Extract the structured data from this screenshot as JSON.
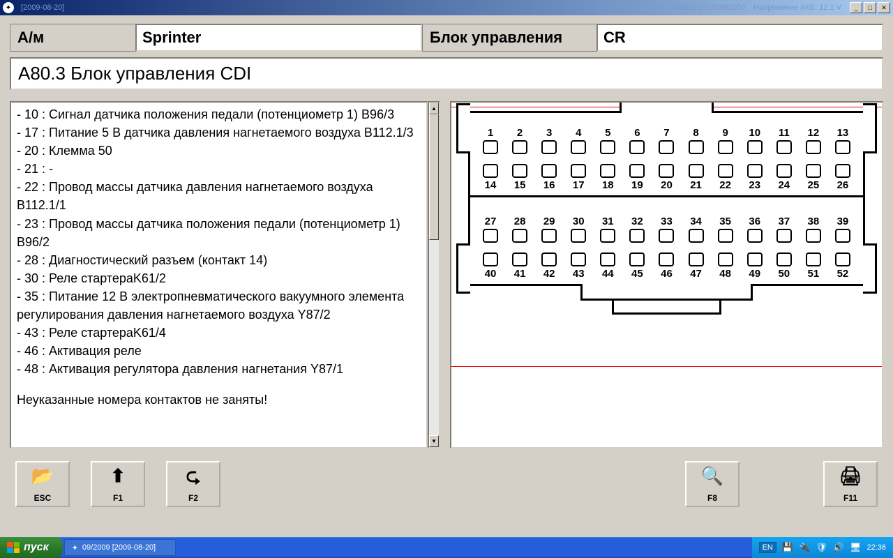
{
  "titlebar": {
    "date": "[2009-08-20]",
    "fin_label": "FIN :",
    "fin_value": "9036221R143961000",
    "voltage_label": "Напряжение АКБ:",
    "voltage_value": "12.1 V"
  },
  "header": {
    "vehicle_label": "А/м",
    "vehicle_value": "Sprinter",
    "ecu_label": "Блок управления",
    "ecu_value": "CR"
  },
  "section_title": "A80.3 Блок управления CDI",
  "pins_text": [
    "- 10 : Сигнал датчика положения педали (потенциометр 1) B96/3",
    "- 17 : Питание 5 В датчика давления нагнетаемого воздуха B112.1/3",
    "- 20 : Клемма 50",
    "- 21 : -",
    "- 22 : Провод массы датчика давления нагнетаемого воздуха B112.1/1",
    "- 23 : Провод массы датчика положения педали (потенциометр 1) B96/2",
    "- 28 : Диагностический разъем (контакт 14)",
    "- 30 : Реле стартераK61/2",
    "- 35 : Питание 12 В электропневматического вакуумного элемента регулирования давления нагнетаемого воздуха Y87/2",
    "- 43 : Реле стартераK61/4",
    "- 46 : Активация реле",
    "- 48 : Активация регулятора давления нагнетания Y87/1"
  ],
  "pins_footer": "Неуказанные номера контактов не заняты!",
  "connector": {
    "row1": [
      "1",
      "2",
      "3",
      "4",
      "5",
      "6",
      "7",
      "8",
      "9",
      "10",
      "11",
      "12",
      "13"
    ],
    "row2": [
      "14",
      "15",
      "16",
      "17",
      "18",
      "19",
      "20",
      "21",
      "22",
      "23",
      "24",
      "25",
      "26"
    ],
    "row3": [
      "27",
      "28",
      "29",
      "30",
      "31",
      "32",
      "33",
      "34",
      "35",
      "36",
      "37",
      "38",
      "39"
    ],
    "row4": [
      "40",
      "41",
      "42",
      "43",
      "44",
      "45",
      "46",
      "47",
      "48",
      "49",
      "50",
      "51",
      "52"
    ]
  },
  "buttons": {
    "esc": "ESC",
    "f1": "F1",
    "f2": "F2",
    "f8": "F8",
    "f11": "F11"
  },
  "taskbar": {
    "start": "пуск",
    "task1": "09/2009 [2009-08-20]",
    "lang": "EN",
    "time": "22:36"
  }
}
